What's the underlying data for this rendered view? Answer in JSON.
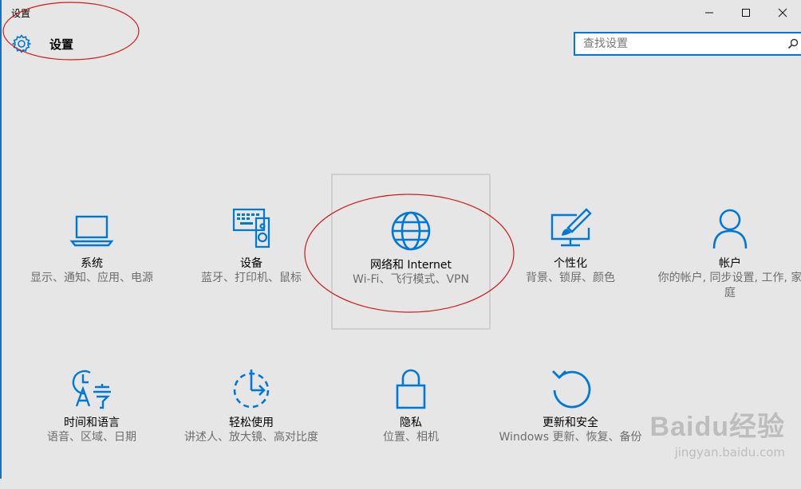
{
  "window": {
    "title": "设置",
    "controls": {
      "minimize": "—",
      "maximize": "□",
      "close": "✕"
    }
  },
  "header": {
    "title": "设置",
    "icon": "gear-icon"
  },
  "search": {
    "placeholder": "查找设置",
    "value": "",
    "icon": "search-icon"
  },
  "colors": {
    "accent": "#0078d7",
    "background": "#e6e6e6",
    "annotation": "#d01b1b"
  },
  "categories": [
    {
      "label": "系统",
      "desc": "显示、通知、应用、电源",
      "icon": "laptop-icon"
    },
    {
      "label": "设备",
      "desc": "蓝牙、打印机、鼠标",
      "icon": "keyboard-speaker-icon"
    },
    {
      "label": "网络和 Internet",
      "desc": "Wi-Fi、飞行模式、VPN",
      "icon": "globe-icon",
      "selected": true
    },
    {
      "label": "个性化",
      "desc": "背景、锁屏、颜色",
      "icon": "paint-monitor-icon"
    },
    {
      "label": "帐户",
      "desc": "你的帐户, 同步设置, 工作, 家庭",
      "icon": "person-icon"
    },
    {
      "label": "时间和语言",
      "desc": "语音、区域、日期",
      "icon": "time-language-icon"
    },
    {
      "label": "轻松使用",
      "desc": "讲述人、放大镜、高对比度",
      "icon": "ease-of-access-icon"
    },
    {
      "label": "隐私",
      "desc": "位置、相机",
      "icon": "lock-icon"
    },
    {
      "label": "更新和安全",
      "desc": "Windows 更新、恢复、备份",
      "icon": "update-icon"
    }
  ],
  "watermark": {
    "brand": "Baidu经验",
    "url": "jingyan.baidu.com"
  }
}
